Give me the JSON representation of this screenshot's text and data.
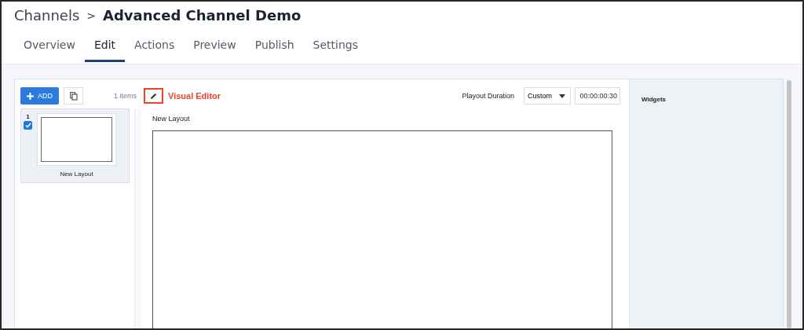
{
  "breadcrumb": {
    "parent": "Channels",
    "separator": ">",
    "current": "Advanced Channel Demo"
  },
  "tabs": [
    {
      "label": "Overview",
      "selected": false
    },
    {
      "label": "Edit",
      "selected": true
    },
    {
      "label": "Actions",
      "selected": false
    },
    {
      "label": "Preview",
      "selected": false
    },
    {
      "label": "Publish",
      "selected": false
    },
    {
      "label": "Settings",
      "selected": false
    }
  ],
  "toolbar": {
    "add_label": "ADD",
    "item_count": "1 items",
    "visual_editor_label": "Visual Editor",
    "playout_label": "Playout Duration",
    "playout_mode": "Custom",
    "duration": "00:00:00:30"
  },
  "layouts": [
    {
      "number": "1",
      "checked": true,
      "name": "New Layout"
    }
  ],
  "editor": {
    "title": "New Layout"
  },
  "widgets": {
    "title": "Widgets"
  }
}
